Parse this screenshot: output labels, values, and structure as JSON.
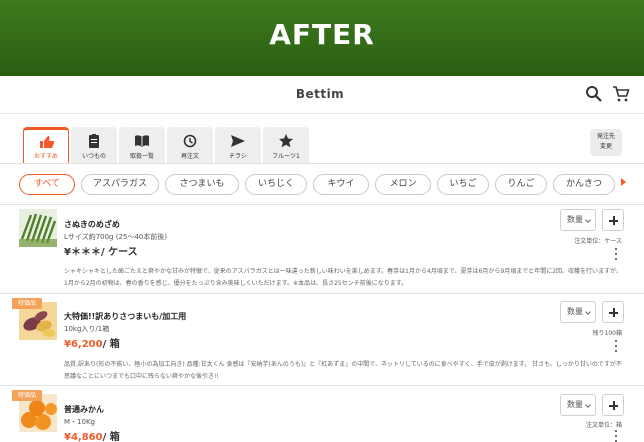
{
  "banner": {
    "title": "AFTER"
  },
  "app": {
    "title": "Bettim"
  },
  "tabs": [
    {
      "label": "おすすめ",
      "icon": "thumb-up-icon"
    },
    {
      "label": "いつもの",
      "icon": "clipboard-icon"
    },
    {
      "label": "取扱一覧",
      "icon": "book-icon"
    },
    {
      "label": "再注文",
      "icon": "history-icon"
    },
    {
      "label": "チラシ",
      "icon": "send-icon"
    },
    {
      "label": "フルーツ1",
      "icon": "star-icon"
    }
  ],
  "destination_button": {
    "line1": "発注先",
    "line2": "変更"
  },
  "chips": [
    "すべて",
    "アスパラガス",
    "さつまいも",
    "いちじく",
    "キウイ",
    "メロン",
    "いちご",
    "りんご",
    "かんきつ"
  ],
  "products": [
    {
      "name": "さぬきのめざめ",
      "spec": "Lサイズ約700g (25〜40本前後)",
      "price": "¥＊＊＊",
      "unit": "/ ケース",
      "qty_label": "数量",
      "unit_note": "注文単位：ケース",
      "description": "シャキシャキとした歯ごたえと爽やかな甘みが特徴で、従来のアスパラガスとは一味違った新しい味わいを楽しめます。春芽は1月から4月頃まで、夏芽は6月から9月頃までと年間に2回、収穫を行いますが、1月から2月の初物は、春の香りを感じ、優分をたっぷり含み美味しくいただけます。※本品は、長さ25センチ前後になります。"
    },
    {
      "badge": "特価品",
      "name": "大特価!!訳ありさつまいも/加工用",
      "spec": "10kg入り/1箱",
      "price": "¥6,200",
      "unit": "/ 箱",
      "qty_label": "数量",
      "unit_note": "残り100箱",
      "description": "品質:訳あり(形の不揃い、極小の為加工向き) 品種:甘太くん 食感は『安納芋(あんのうも)』と『紅あずま』の中間で、ネットリしているのに食べやすく、手で皮が剥けます。 甘さも、しっかり甘いのですが不思議なことにいつまでも口中に残らない爽やかな後引き!!"
    },
    {
      "badge": "特価品",
      "name": "普通みかん",
      "spec": "M・10Kg",
      "price": "¥4,860",
      "unit": "/ 箱",
      "qty_label": "数量",
      "unit_note": "注文単位：箱"
    }
  ],
  "colors": {
    "accent": "#f05a28",
    "banner": "#2f6616"
  }
}
